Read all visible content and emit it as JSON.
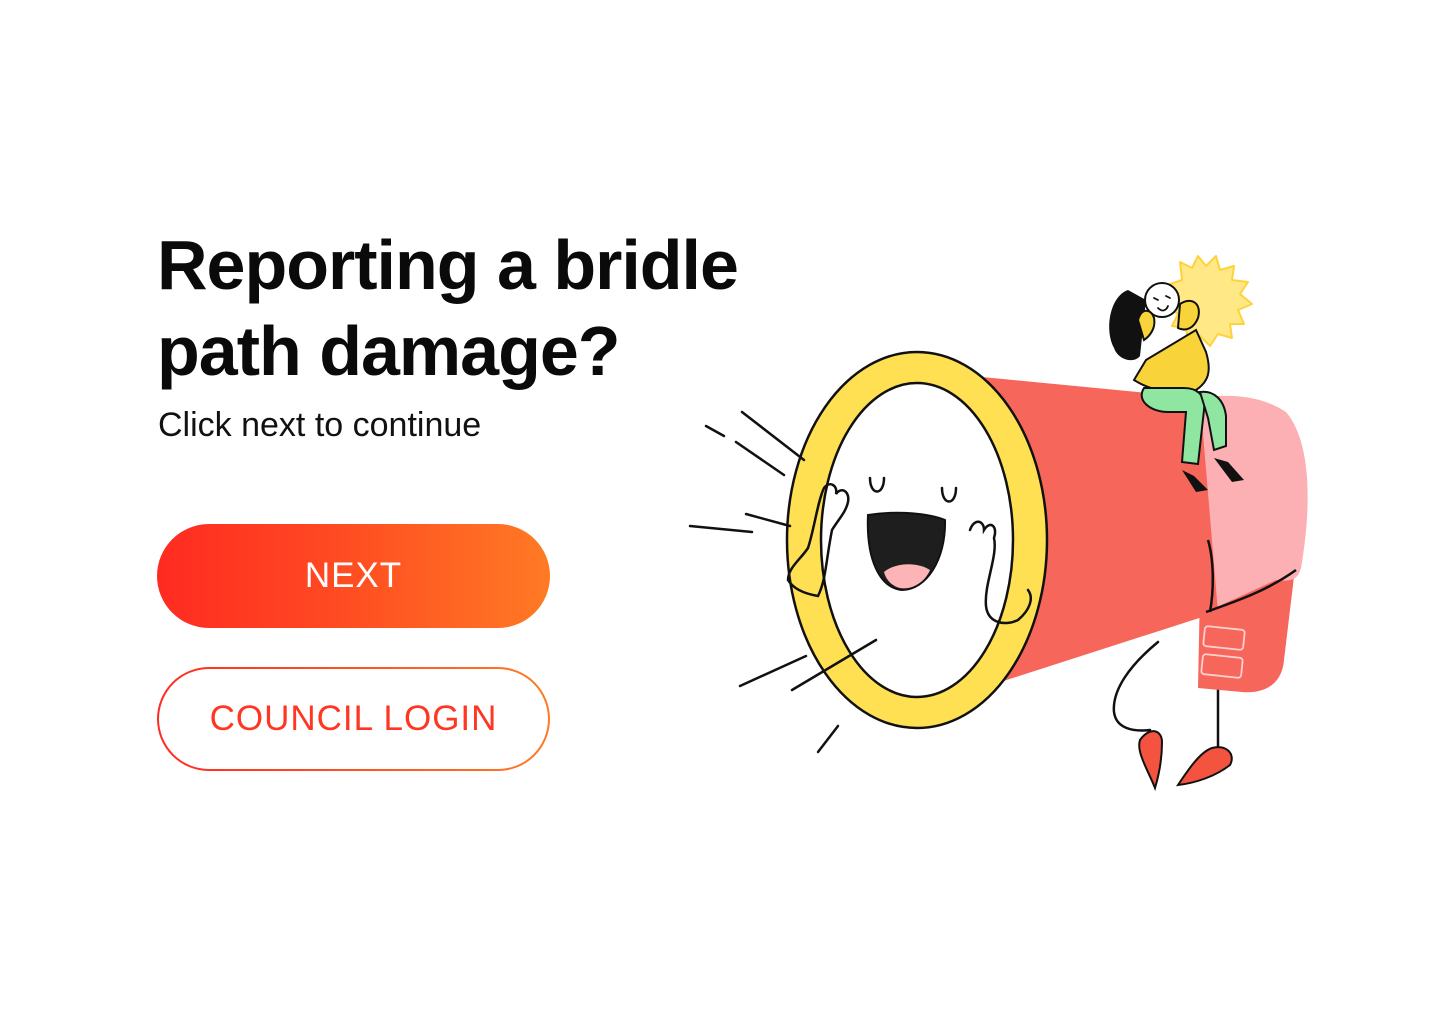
{
  "hero": {
    "title": "Reporting a bridle path damage?",
    "subtitle": "Click next to continue"
  },
  "actions": {
    "next_label": "NEXT",
    "council_login_label": "COUNCIL LOGIN"
  },
  "colors": {
    "primary_gradient_start": "#ff2a22",
    "primary_gradient_end": "#ff7a24",
    "text": "#0a0a0a",
    "megaphone_red": "#f6665a",
    "megaphone_pink": "#fdb0b3",
    "rim_yellow": "#ffe053"
  },
  "illustration": {
    "icon": "megaphone-character-icon"
  }
}
